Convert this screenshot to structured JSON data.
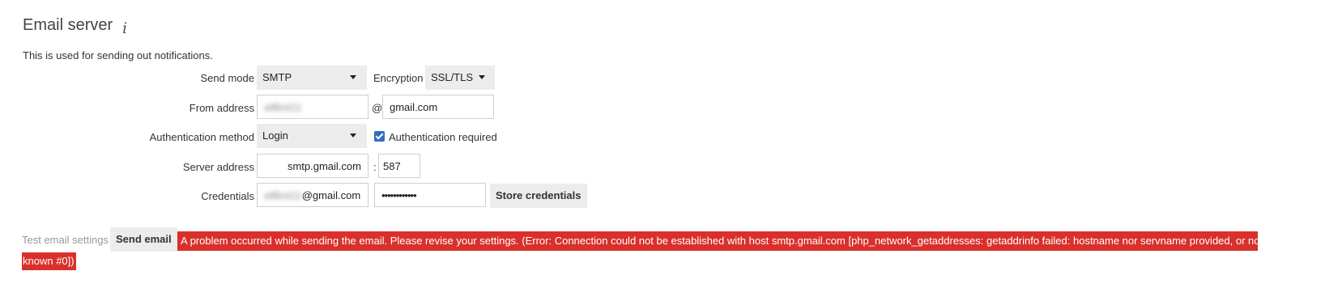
{
  "section": {
    "title": "Email server",
    "description": "This is used for sending out notifications."
  },
  "send_mode": {
    "label": "Send mode",
    "value": "SMTP"
  },
  "encryption": {
    "label": "Encryption",
    "value": "SSL/TLS"
  },
  "from_address": {
    "label": "From address",
    "user_value": "wllbot11",
    "at": "@",
    "domain_value": "gmail.com"
  },
  "auth_method": {
    "label": "Authentication method",
    "value": "Login",
    "required_label": "Authentication required",
    "required_checked": true
  },
  "server": {
    "label": "Server address",
    "host": "smtp.gmail.com",
    "colon": ":",
    "port": "587"
  },
  "credentials": {
    "label": "Credentials",
    "user_blurred": "wllbot11",
    "user_domain": "@gmail.com",
    "password": "••••••••••••",
    "store_button": "Store credentials"
  },
  "test": {
    "label": "Test email settings",
    "button": "Send email",
    "error_line1": "A problem occurred while sending the email. Please revise your settings. (Error: Connection could not be established with host smtp.gmail.com [php_network_getaddresses: getaddrinfo failed: hostname nor servname provided, or not",
    "error_line2": "known #0])"
  },
  "colors": {
    "error_bg": "#d9302c",
    "checkbox": "#2f6fbf",
    "control_bg": "#ececec"
  },
  "icons": {
    "info": "info-icon",
    "dropdown": "chevron-down-icon",
    "check": "check-icon"
  }
}
